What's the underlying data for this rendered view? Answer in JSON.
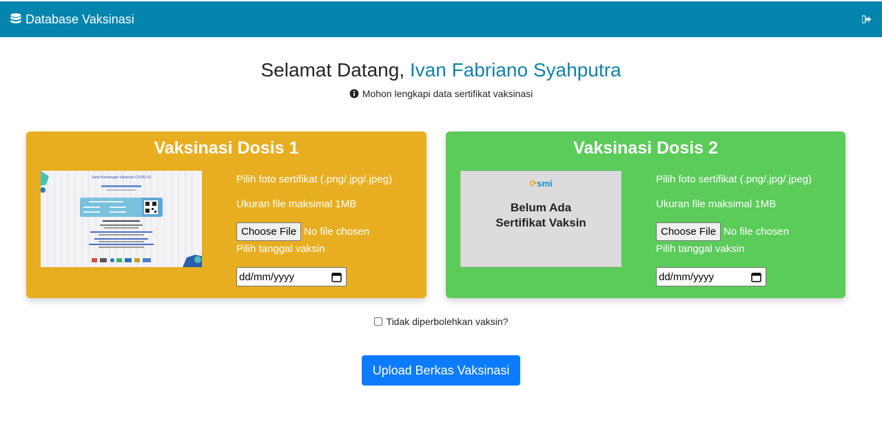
{
  "navbar": {
    "brand_icon": "database-icon",
    "brand_label": "Database Vaksinasi",
    "logout_icon": "sign-out-icon"
  },
  "welcome": {
    "greeting": "Selamat Datang,",
    "name": "Ivan Fabriano Syahputra",
    "note_icon": "info-circle-icon",
    "note": "Mohon lengkapi data sertifikat vaksinasi"
  },
  "colors": {
    "navbar": "#0485ad",
    "dose1_card": "#e7ae21",
    "dose2_card": "#5bcb5a",
    "accent_name": "#1381a8",
    "upload_button": "#0d7bfd"
  },
  "dose1": {
    "title": "Vaksinasi Dosis 1",
    "certificate_title": "Surat Keterangan Vaksinasi COVID-19",
    "file_hint": "Pilih foto sertifikat (.png/.jpg/.jpeg)",
    "size_hint": "Ukuran file maksimal 1MB",
    "choose_label": "Choose File",
    "no_file": "No file chosen",
    "date_label": "Pilih tanggal vaksin",
    "date_placeholder": "dd/mm/yyyy"
  },
  "dose2": {
    "title": "Vaksinasi Dosis 2",
    "logo_text": "smi",
    "placeholder_line1": "Belum Ada",
    "placeholder_line2": "Sertifikat Vaksin",
    "file_hint": "Pilih foto sertifikat (.png/.jpg/.jpeg)",
    "size_hint": "Ukuran file maksimal 1MB",
    "choose_label": "Choose File",
    "no_file": "No file chosen",
    "date_label": "Pilih tanggal vaksin",
    "date_placeholder": "dd/mm/yyyy"
  },
  "checkbox": {
    "label": "Tidak diperbolehkan vaksin?",
    "checked": false
  },
  "upload_button": "Upload Berkas Vaksinasi"
}
